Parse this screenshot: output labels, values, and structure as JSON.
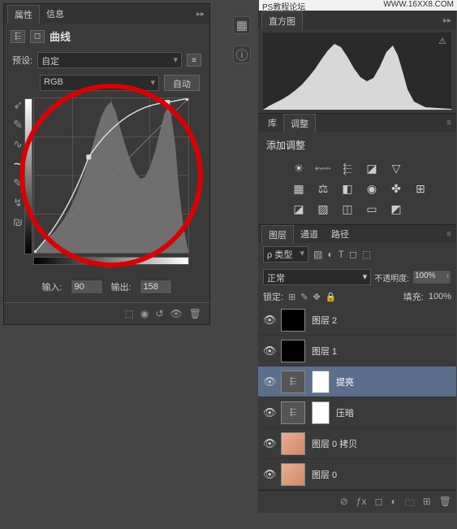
{
  "watermark": {
    "left": "PS教程论坛",
    "right": "WWW.16XX8.COM"
  },
  "propertiesPanel": {
    "tabs": {
      "properties": "属性",
      "info": "信息"
    },
    "title": "曲线",
    "presetLabel": "预设:",
    "preset": "自定",
    "channel": "RGB",
    "autoButton": "自动",
    "inputLabel": "输入:",
    "inputValue": "90",
    "outputLabel": "输出:",
    "outputValue": "158"
  },
  "chart_data": {
    "type": "line",
    "title": "曲线",
    "xlabel": "输入",
    "ylabel": "输出",
    "xlim": [
      0,
      255
    ],
    "ylim": [
      0,
      255
    ],
    "series": [
      {
        "name": "curve",
        "x": [
          0,
          90,
          220,
          255
        ],
        "y": [
          0,
          158,
          248,
          255
        ]
      },
      {
        "name": "baseline",
        "x": [
          0,
          255
        ],
        "y": [
          0,
          255
        ]
      }
    ],
    "selected_point": {
      "input": 90,
      "output": 158
    },
    "histogram_background": {
      "note": "grey histogram of image luminance, approx bins 0-255",
      "approx_values": [
        5,
        6,
        7,
        8,
        10,
        11,
        12,
        14,
        16,
        18,
        20,
        22,
        24,
        26,
        28,
        31,
        34,
        38,
        42,
        46,
        50,
        55,
        60,
        66,
        73,
        80,
        88,
        96,
        106,
        118,
        130,
        145,
        160,
        175,
        188,
        195,
        188,
        170,
        150,
        132,
        118,
        108,
        100,
        95,
        92,
        96,
        104,
        118,
        140,
        165,
        190,
        205,
        180,
        150,
        120,
        95,
        75,
        58,
        45,
        32,
        22,
        15,
        10,
        6
      ]
    }
  },
  "histogramPanel": {
    "tab": "直方图",
    "approx_values": [
      4,
      5,
      6,
      7,
      9,
      11,
      13,
      15,
      17,
      19,
      22,
      25,
      28,
      32,
      36,
      41,
      47,
      54,
      62,
      71,
      80,
      88,
      93,
      89,
      80,
      70,
      61,
      54,
      48,
      44,
      42,
      45,
      52,
      63,
      78,
      93,
      98,
      86,
      70,
      55,
      42,
      32,
      24,
      18,
      13,
      9,
      6,
      4,
      3,
      2,
      2,
      1,
      1,
      1,
      1,
      1
    ]
  },
  "adjustPanel": {
    "tabs": {
      "lib": "库",
      "adjust": "调整"
    },
    "title": "添加调整"
  },
  "layersPanel": {
    "tabs": {
      "layers": "图层",
      "channels": "通道",
      "paths": "路径"
    },
    "kindLabel": "ρ 类型",
    "blendMode": "正常",
    "opacityLabel": "不透明度:",
    "opacity": "100%",
    "lockLabel": "锁定:",
    "fillLabel": "填充:",
    "fill": "100%",
    "items": [
      {
        "name": "图层 2",
        "type": "black",
        "visible": true
      },
      {
        "name": "图层 1",
        "type": "black",
        "visible": true
      },
      {
        "name": "提亮",
        "type": "curves",
        "visible": true,
        "selected": true
      },
      {
        "name": "压暗",
        "type": "curves",
        "visible": true
      },
      {
        "name": "图层 0 拷贝",
        "type": "face",
        "visible": true
      },
      {
        "name": "图层 0",
        "type": "face",
        "visible": true
      }
    ]
  }
}
